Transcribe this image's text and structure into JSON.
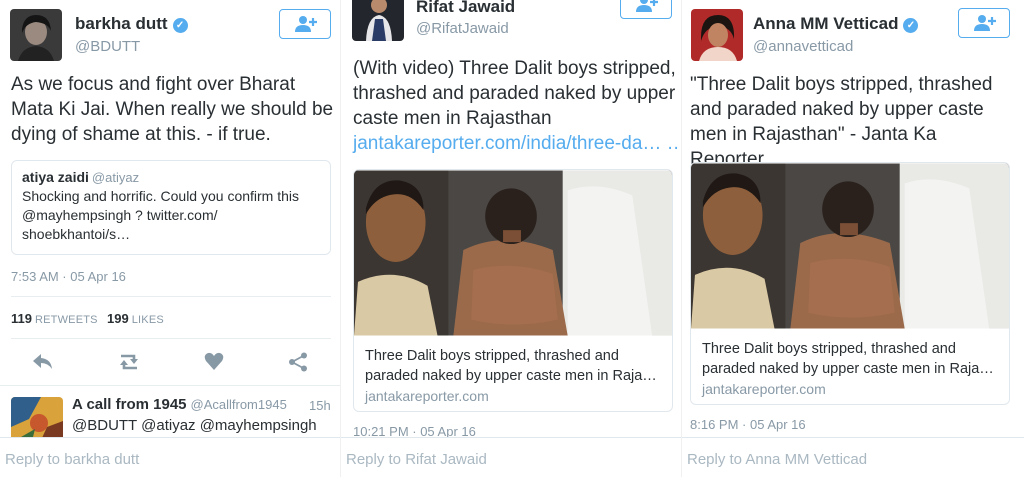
{
  "panels": [
    {
      "author": {
        "name": "barkha dutt",
        "handle": "@BDUTT",
        "verified": true
      },
      "text": "As we focus and fight over Bharat Mata Ki Jai. When really we should be dying of shame at this. - if true.",
      "quote": {
        "name": "atiya zaidi",
        "handle": "@atiyaz",
        "text": "Shocking and horrific. Could you confirm this @mayhempsingh ? twitter.com/ shoebkhantoi/s…"
      },
      "timestamp": "7:53 AM · 05 Apr 16",
      "stats": {
        "retweets": "119",
        "retweets_label": "RETWEETS",
        "likes": "199",
        "likes_label": "LIKES"
      },
      "reply": {
        "name": "A call from 1945",
        "handle": "@Acallfrom1945",
        "time": "15h",
        "text": "@BDUTT @atiyaz @mayhempsingh"
      },
      "reply_placeholder": "Reply to barkha dutt"
    },
    {
      "author": {
        "name": "Rifat Jawaid",
        "handle": "@RifatJawaid",
        "verified": false
      },
      "text": "(With video) Three Dalit boys stripped, thrashed and paraded naked by upper caste men in Rajasthan",
      "link": "jantakareporter.com/india/three-da… …",
      "card": {
        "title": "Three Dalit boys stripped, thrashed and paraded naked by upper caste men in Raja…",
        "domain": "jantakareporter.com"
      },
      "timestamp": "10:21 PM · 05 Apr 16",
      "reply_placeholder": "Reply to Rifat Jawaid"
    },
    {
      "author": {
        "name": "Anna MM Vetticad",
        "handle": "@annavetticad",
        "verified": true
      },
      "text": "\"Three Dalit boys stripped, thrashed and paraded naked by upper caste men in Rajasthan\" - Janta Ka Reporter",
      "card": {
        "title": "Three Dalit boys stripped, thrashed and paraded naked by upper caste men in Raja…",
        "domain": "jantakareporter.com"
      },
      "timestamp": "8:16 PM · 05 Apr 16",
      "reply_placeholder": "Reply to Anna MM Vetticad"
    }
  ],
  "colors": {
    "accent": "#55acee",
    "text": "#292f33",
    "muted": "#8899a6",
    "like": "#8899a6"
  },
  "icons": [
    "verified-badge-icon",
    "follow-user-icon",
    "reply-icon",
    "retweet-icon",
    "like-icon",
    "share-icon"
  ]
}
